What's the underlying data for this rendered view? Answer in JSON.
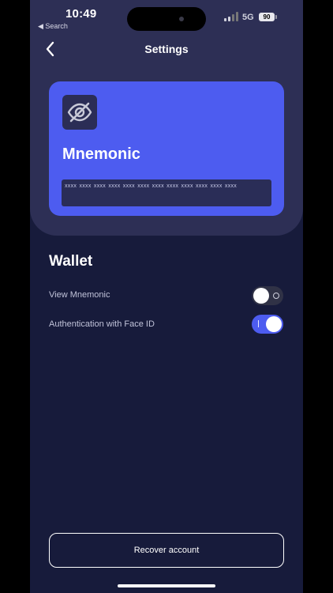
{
  "status_bar": {
    "time": "10:49",
    "back_app": "◀ Search",
    "network": "5G",
    "battery": "90"
  },
  "header": {
    "title": "Settings",
    "back_icon": "chevron-left-icon"
  },
  "card": {
    "icon": "eye-off-icon",
    "title": "Mnemonic",
    "mnemonic_masked": "xxxx xxxx xxxx xxxx xxxx xxxx xxxx xxxx xxxx xxxx xxxx xxxx"
  },
  "wallet": {
    "title": "Wallet",
    "settings": [
      {
        "label": "View Mnemonic",
        "enabled": false
      },
      {
        "label": "Authentication with Face ID",
        "enabled": true
      }
    ]
  },
  "footer": {
    "recover_label": "Recover account"
  },
  "colors": {
    "accent": "#4d5cf0",
    "background": "#171b3b",
    "panel": "#2d2f55"
  }
}
